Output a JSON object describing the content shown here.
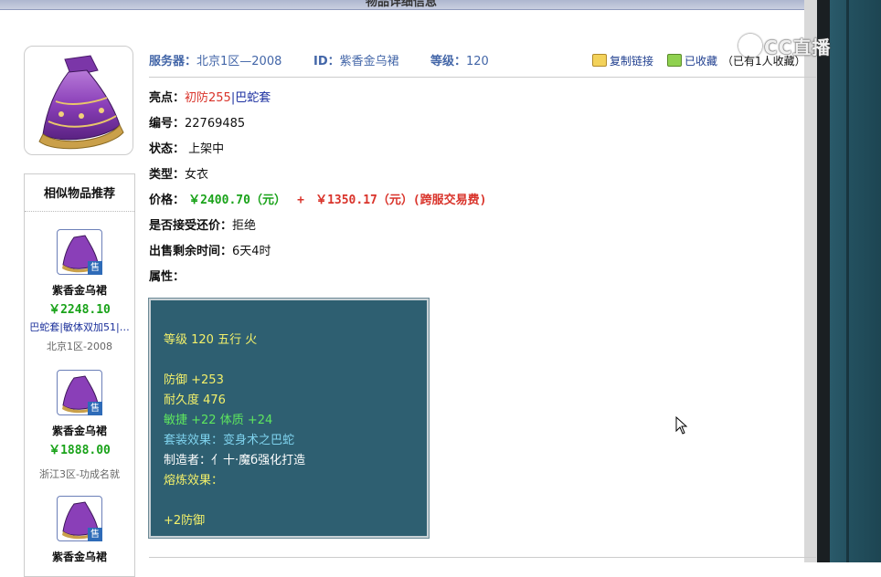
{
  "page": {
    "top_title": "物品详细信息"
  },
  "watermark": {
    "text": "CC直播"
  },
  "header": {
    "server_label": "服务器：",
    "server_value": "北京1区—2008",
    "id_label": "ID：",
    "id_value": "紫香金乌裙",
    "level_label": "等级：",
    "level_value": "120",
    "copy_link": "复制链接",
    "favorited": "已收藏",
    "favorite_count": "（已有1人收藏）"
  },
  "details": {
    "highlight_label": "亮点：",
    "highlight_red": "初防255",
    "highlight_sep": "|",
    "highlight_link": "巴蛇套",
    "number_label": "编号：",
    "number_value": "22769485",
    "status_label": "状态：",
    "status_value": " 上架中",
    "type_label": "类型：",
    "type_value": "女衣",
    "price_label": "价格：",
    "price_main": "￥2400.70（元）",
    "price_plus": "+",
    "price_fee": "￥1350.17（元）(跨服交易费)",
    "bargain_label": "是否接受还价：",
    "bargain_value": "拒绝",
    "remaining_label": "出售剩余时间：",
    "remaining_value": "6天4时",
    "attr_label": "属性："
  },
  "attributes": {
    "line1": "等级 120 五行 火",
    "line2": "防御 +253",
    "line3": "耐久度 476",
    "line4": "敏捷 +22 体质 +24",
    "line5": "套装效果：变身术之巴蛇",
    "line6": "制造者：亻十·魔б强化打造",
    "line7": "熔炼效果：",
    "line8": "+2防御"
  },
  "similar": {
    "title": "相似物品推荐",
    "sell_badge": "售",
    "items": [
      {
        "name": "紫香金乌裙",
        "price": "￥2248.10",
        "tags": "巴蛇套|敏体双加51|…",
        "server": "北京1区-2008"
      },
      {
        "name": "紫香金乌裙",
        "price": "￥1888.00",
        "tags": "",
        "server": "浙江3区-功成名就"
      },
      {
        "name": "紫香金乌裙",
        "price": "",
        "tags": "",
        "server": ""
      }
    ]
  },
  "colors": {
    "accent_blue": "#4366a8",
    "price_green": "#1aa31a",
    "price_red": "#d9332a",
    "attr_bg": "#2e5f71"
  }
}
